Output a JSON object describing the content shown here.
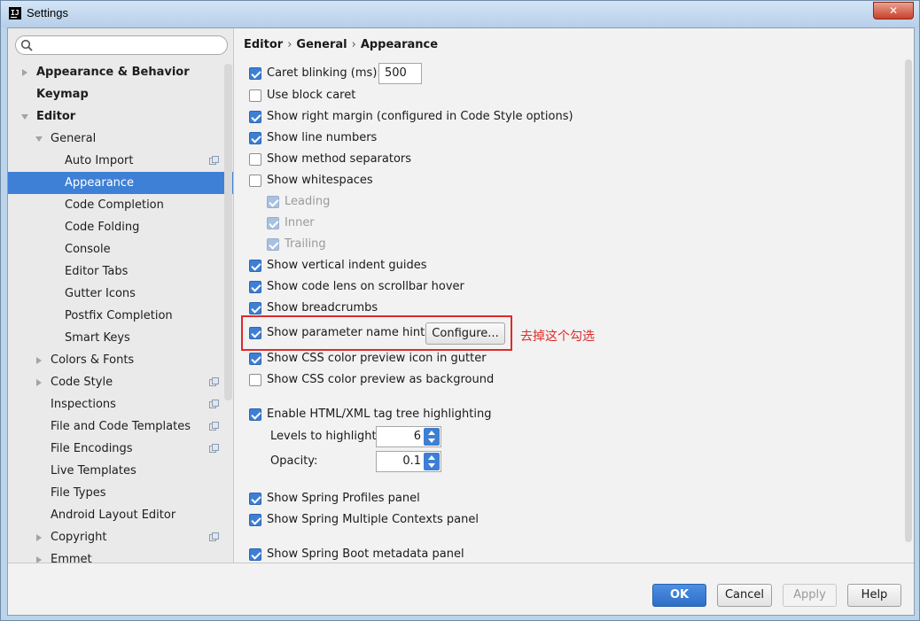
{
  "window": {
    "title": "Settings",
    "close_glyph": "✕"
  },
  "search": {
    "placeholder": "",
    "value": ""
  },
  "sidebar": {
    "items": [
      {
        "label": "Appearance & Behavior",
        "bold": true
      },
      {
        "label": "Keymap",
        "bold": true
      },
      {
        "label": "Editor",
        "bold": true
      },
      {
        "label": "General"
      },
      {
        "label": "Auto Import"
      },
      {
        "label": "Appearance",
        "selected": true
      },
      {
        "label": "Code Completion"
      },
      {
        "label": "Code Folding"
      },
      {
        "label": "Console"
      },
      {
        "label": "Editor Tabs"
      },
      {
        "label": "Gutter Icons"
      },
      {
        "label": "Postfix Completion"
      },
      {
        "label": "Smart Keys"
      },
      {
        "label": "Colors & Fonts"
      },
      {
        "label": "Code Style"
      },
      {
        "label": "Inspections"
      },
      {
        "label": "File and Code Templates"
      },
      {
        "label": "File Encodings"
      },
      {
        "label": "Live Templates"
      },
      {
        "label": "File Types"
      },
      {
        "label": "Android Layout Editor"
      },
      {
        "label": "Copyright"
      },
      {
        "label": "Emmet"
      }
    ]
  },
  "breadcrumb": {
    "part1": "Editor",
    "part2": "General",
    "part3": "Appearance",
    "separator": "›"
  },
  "options": {
    "caret_blinking": {
      "label": "Caret blinking (ms):",
      "checked": true,
      "value": "500"
    },
    "use_block_caret": {
      "label": "Use block caret",
      "checked": false
    },
    "show_right_margin": {
      "label": "Show right margin (configured in Code Style options)",
      "checked": true
    },
    "show_line_numbers": {
      "label": "Show line numbers",
      "checked": true
    },
    "show_method_separators": {
      "label": "Show method separators",
      "checked": false
    },
    "show_whitespaces": {
      "label": "Show whitespaces",
      "checked": false
    },
    "leading": {
      "label": "Leading",
      "checked": true,
      "disabled": true
    },
    "inner": {
      "label": "Inner",
      "checked": true,
      "disabled": true
    },
    "trailing": {
      "label": "Trailing",
      "checked": true,
      "disabled": true
    },
    "show_indent_guides": {
      "label": "Show vertical indent guides",
      "checked": true
    },
    "show_code_lens": {
      "label": "Show code lens on scrollbar hover",
      "checked": true
    },
    "show_breadcrumbs": {
      "label": "Show breadcrumbs",
      "checked": true
    },
    "show_param_hints": {
      "label": "Show parameter name hints",
      "checked": true,
      "configure_label": "Configure..."
    },
    "annotation": "去掉这个勾选",
    "css_color_icon": {
      "label": "Show CSS color preview icon in gutter",
      "checked": true
    },
    "css_color_bg": {
      "label": "Show CSS color preview as background",
      "checked": false
    },
    "tag_tree": {
      "label": "Enable HTML/XML tag tree highlighting",
      "checked": true
    },
    "levels": {
      "label": "Levels to highlight:",
      "value": "6"
    },
    "opacity": {
      "label": "Opacity:",
      "value": "0.1"
    },
    "spring_profiles": {
      "label": "Show Spring Profiles panel",
      "checked": true
    },
    "spring_contexts": {
      "label": "Show Spring Multiple Contexts panel",
      "checked": true
    },
    "spring_boot": {
      "label": "Show Spring Boot metadata panel",
      "checked": true
    }
  },
  "footer": {
    "ok": "OK",
    "cancel": "Cancel",
    "apply": "Apply",
    "help": "Help"
  },
  "colors": {
    "accent": "#3e80d6",
    "annotation": "#e02a2a"
  }
}
